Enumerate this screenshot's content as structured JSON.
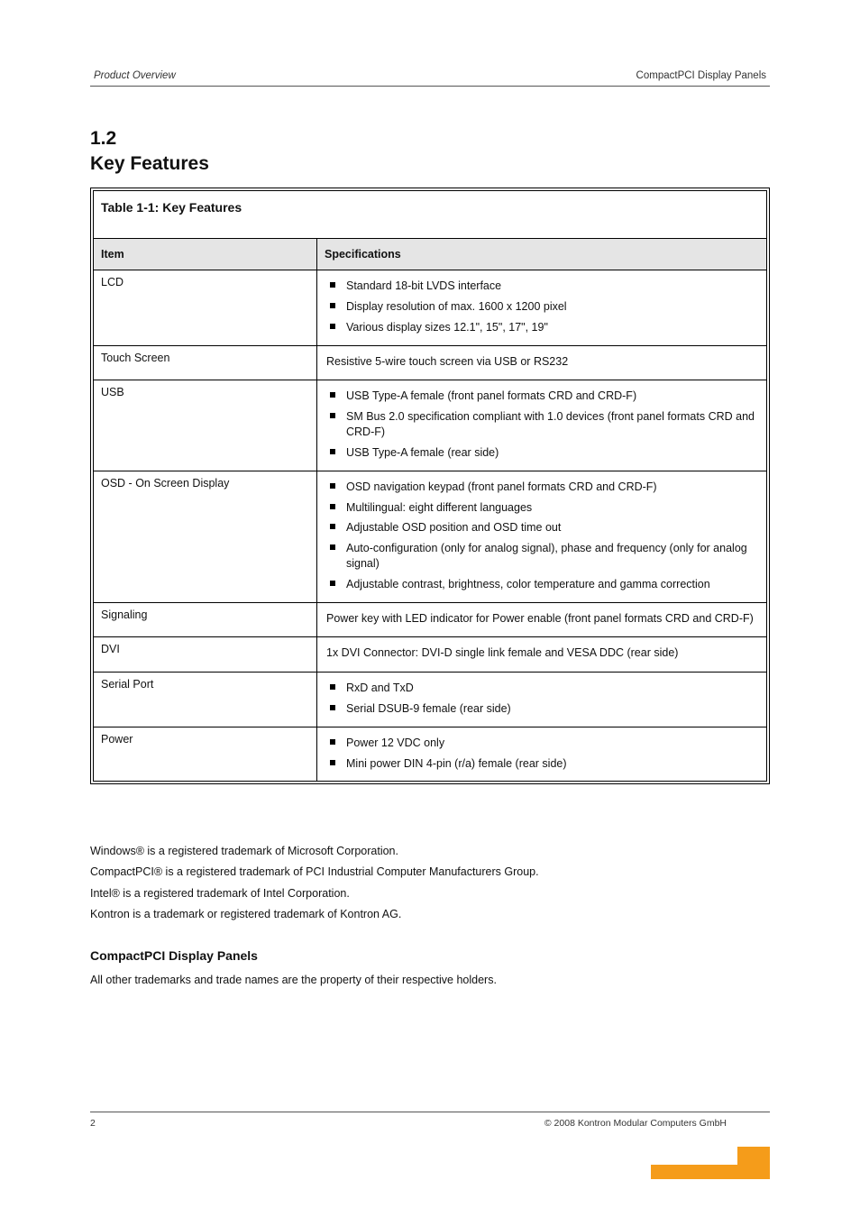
{
  "header": {
    "left": "Product Overview",
    "right": "CompactPCI Display Panels"
  },
  "section": {
    "number": "1.2",
    "title": "Key Features"
  },
  "table": {
    "title": "Table 1-1: Key Features",
    "head": {
      "item": "Item",
      "spec": "Specifications"
    },
    "rows": [
      {
        "item": "LCD",
        "bullets": [
          "Standard 18-bit LVDS interface",
          "Display resolution of max. 1600 x 1200 pixel",
          "Various display sizes 12.1\", 15\", 17\", 19\""
        ]
      },
      {
        "item": "Touch Screen",
        "text": "Resistive 5-wire touch screen via USB or RS232"
      },
      {
        "item": "USB",
        "bullets": [
          "USB Type-A female (front panel formats CRD and CRD-F)",
          "SM Bus 2.0 specification compliant with 1.0 devices (front panel formats CRD and CRD-F)",
          "USB Type-A female (rear side)"
        ]
      },
      {
        "item": "OSD - On Screen Display",
        "bullets": [
          "OSD navigation keypad (front panel formats CRD and CRD-F)",
          "Multilingual: eight different languages",
          "Adjustable OSD position and OSD time out",
          "Auto-configuration (only for analog signal), phase and frequency (only for analog signal)",
          "Adjustable contrast, brightness, color temperature and gamma correction"
        ]
      },
      {
        "item": "Signaling",
        "text": "Power key with LED indicator for Power enable (front panel formats CRD and CRD-F)"
      },
      {
        "item": "DVI",
        "text": "1x DVI Connector: DVI-D single link female and VESA DDC (rear side)"
      },
      {
        "item": "Serial Port",
        "bullets": [
          "RxD and TxD",
          "Serial DSUB-9 female (rear side)"
        ]
      },
      {
        "item": "Power",
        "bullets": [
          "Power 12 VDC only",
          "Mini power DIN 4-pin (r/a) female (rear side)"
        ]
      }
    ]
  },
  "credits": {
    "line1": "Windows® is a registered trademark of Microsoft Corporation.",
    "line2": "CompactPCI® is a registered trademark of PCI Industrial Computer Manufacturers Group.",
    "line3": "Intel® is a registered trademark of Intel Corporation.",
    "line4": "Kontron is a trademark or registered trademark of Kontron AG.",
    "product": "CompactPCI Display Panels",
    "trademark": "All other trademarks and trade names are the property of their respective holders."
  },
  "footer": {
    "page": "2",
    "copyright": "© 2008 Kontron Modular Computers GmbH"
  }
}
